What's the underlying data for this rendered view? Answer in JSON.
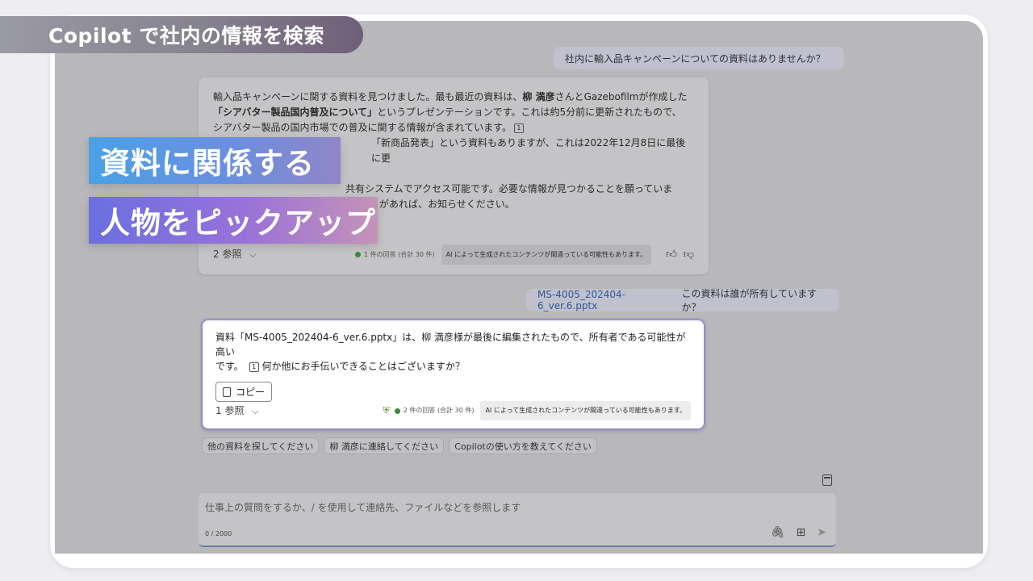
{
  "title": "Copilot で社内の情報を検索",
  "user_message_1": "社内に輸入品キャンペーンについての資料はありませんか？",
  "response_1": {
    "line1a": "輸入品キャンペーンに関する資料を見つけました。最も最近の資料は、",
    "line1b": "柳 満彦",
    "line1c": "さんとGazebofilmが作成した",
    "line2a": "「シアバター製品国内普及について」",
    "line2b": "というプレゼンテーションです。これは約5分前に更新されたもので、",
    "line3": "シアバター製品の国内市場での普及に関する情報が含まれています。",
    "ref": "1",
    "line4": "「新商品発表」という資料もありますが、これは2022年12月8日に最後に更",
    "line5": "共有システムでアクセス可能です。必要な情報が見つかることを願っていま",
    "line6": "があれば、お知らせください。",
    "refs_label": "2 参照",
    "response_count": "1 件の回答 (合計 30 件)",
    "ai_notice": "AI によって生成されたコンテンツが間違っている可能性もあります。"
  },
  "overlay_1": "資料に関係する",
  "overlay_2": "人物をピックアップ",
  "user_message_2": {
    "file": "MS-4005_202404-6_ver.6.pptx",
    "question": "この資料は誰が所有していますか？"
  },
  "response_2": {
    "line1": "資料「MS-4005_202404-6_ver.6.pptx」は、柳 満彦様が最後に編集されたもので、所有者である可能性が高い",
    "line2a": "です。",
    "ref": "1",
    "line2b": "何か他にお手伝いできることはございますか？",
    "copy_label": "コピー",
    "refs_label": "1 参照",
    "response_count": "2 件の回答 (合計 30 件)",
    "ai_notice": "AI によって生成されたコンテンツが間違っている可能性もあります。"
  },
  "suggestions": [
    "他の資料を探してください",
    "柳 満彦に連絡してください",
    "Copilotの使い方を教えてください"
  ],
  "input": {
    "placeholder": "仕事上の質問をするか、/ を使用して連絡先、ファイルなどを参照します",
    "counter": "0 / 2000"
  },
  "icons": {
    "chevron": "⌵",
    "thumbs_up": "👍︎",
    "thumbs_down": "👎︎",
    "shield": "⛨",
    "attach": "🖇︎",
    "apps": "⊞",
    "send": "➤"
  }
}
